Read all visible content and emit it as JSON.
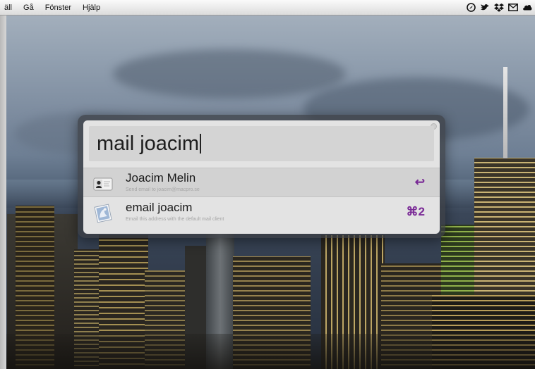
{
  "menubar": {
    "items": [
      "äll",
      "Gå",
      "Fönster",
      "Hjälp"
    ],
    "status_icons": [
      "compass-icon",
      "bird-icon",
      "dropbox-icon",
      "mail-icon",
      "cloud-icon"
    ]
  },
  "launcher": {
    "query": "mail joacim",
    "results": [
      {
        "title": "Joacim Melin",
        "subtitle": "Send email to joacim@macpro.se",
        "shortcut": "↩",
        "icon": "contact-card-icon",
        "selected": true
      },
      {
        "title": "email joacim",
        "subtitle": "Email this address with the default mail client",
        "shortcut": "⌘2",
        "icon": "mail-stamp-icon",
        "selected": false
      }
    ]
  },
  "colors": {
    "shortcut": "#7a2a96",
    "selected_row": "#d2d2d2",
    "panel_bg": "#e3e3e3"
  }
}
